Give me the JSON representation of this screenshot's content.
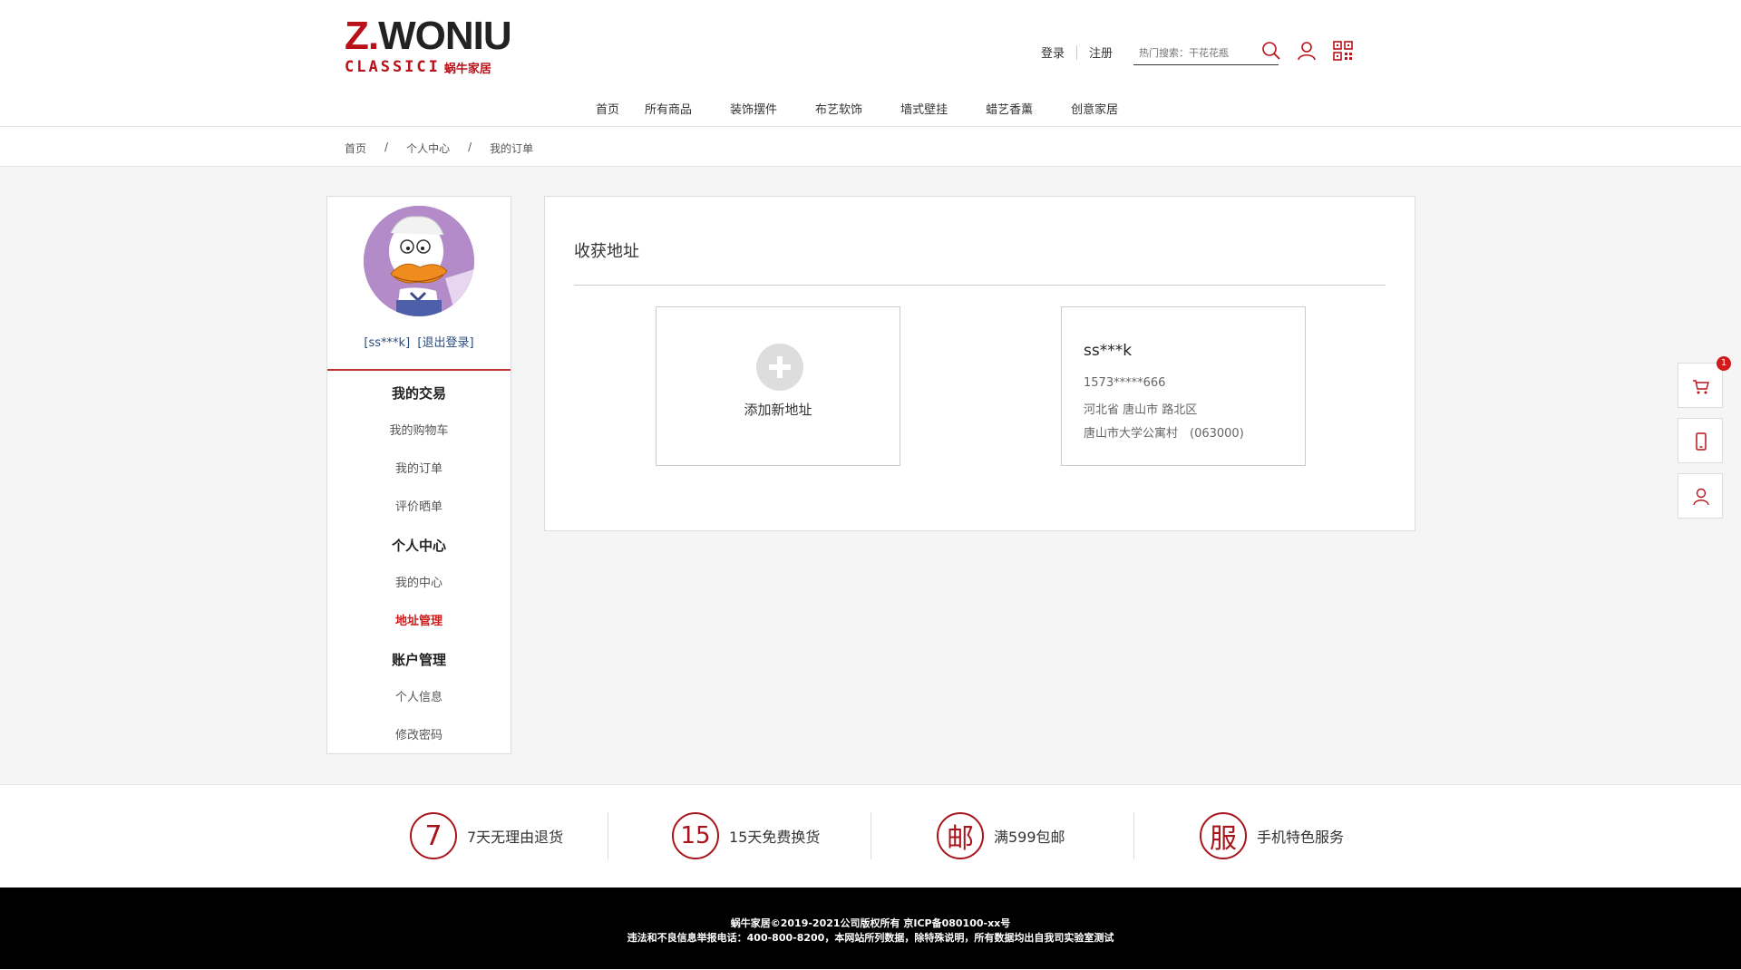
{
  "brand": {
    "logo_top_z": "Z",
    "logo_top_dot": ".",
    "logo_top_rest": "WONIU",
    "logo_classic": "CLASSICI",
    "logo_cn": "蜗牛家居",
    "color": "#b8111a"
  },
  "header": {
    "login": "登录",
    "register": "注册",
    "search_placeholder": "热门搜索：干花花瓶",
    "icons": [
      "search-icon",
      "user-icon",
      "qrcode-icon"
    ]
  },
  "nav": [
    "首页",
    "所有商品",
    "装饰摆件",
    "布艺软饰",
    "墙式壁挂",
    "蜡艺香薰",
    "创意家居"
  ],
  "breadcrumb": {
    "items": [
      "首页",
      "个人中心",
      "我的订单"
    ],
    "separator": "/"
  },
  "sidebar": {
    "username": "[ss***k]",
    "logout": "[退出登录]",
    "groups": [
      {
        "title": "我的交易",
        "items": [
          "我的购物车",
          "我的订单",
          "评价晒单"
        ]
      },
      {
        "title": "个人中心",
        "items": [
          "我的中心",
          "地址管理"
        ]
      },
      {
        "title": "账户管理",
        "items": [
          "个人信息",
          "修改密码"
        ]
      }
    ],
    "active_item": "地址管理",
    "active_color": "#d11b1b"
  },
  "content": {
    "title": "收获地址",
    "add_label": "添加新地址",
    "address": {
      "name": "ss***k",
      "phone": "1573*****666",
      "region": "河北省 唐山市 路北区",
      "detail": "唐山市大学公寓村　(063000)"
    }
  },
  "float_bar": {
    "cart_badge": "1",
    "icons": [
      "cart-icon",
      "mobile-icon",
      "user-icon"
    ]
  },
  "services": [
    {
      "symbol": "7",
      "label": "7天无理由退货"
    },
    {
      "symbol": "15",
      "label": "15天免费换货"
    },
    {
      "symbol": "邮",
      "label": "满599包邮"
    },
    {
      "symbol": "服",
      "label": "手机特色服务"
    }
  ],
  "footer": {
    "line1": "蜗牛家居©2019-2021公司版权所有 京ICP备080100-xx号",
    "line2": "违法和不良信息举报电话：400-800-8200，本网站所列数据，除特殊说明，所有数据均出自我司实验室测试"
  }
}
